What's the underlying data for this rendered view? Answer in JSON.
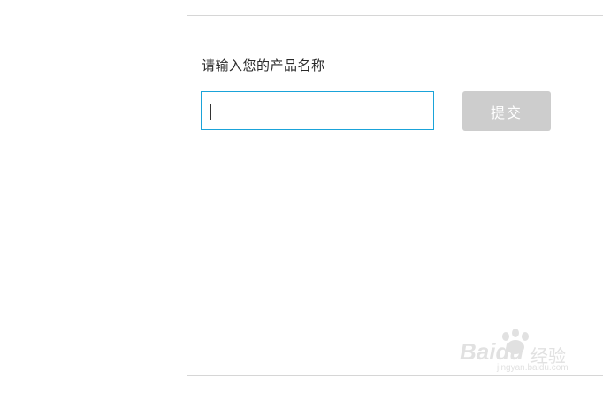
{
  "form": {
    "prompt_label": "请输入您的产品名称",
    "input_value": "",
    "submit_label": "提交"
  },
  "colors": {
    "input_border": "#1aa3d9",
    "submit_bg": "#cdcdcd",
    "divider": "#d6d6d6"
  },
  "watermark": {
    "brand": "Baidu",
    "brand_cn": "经验",
    "url": "jingyan.baidu.com"
  }
}
